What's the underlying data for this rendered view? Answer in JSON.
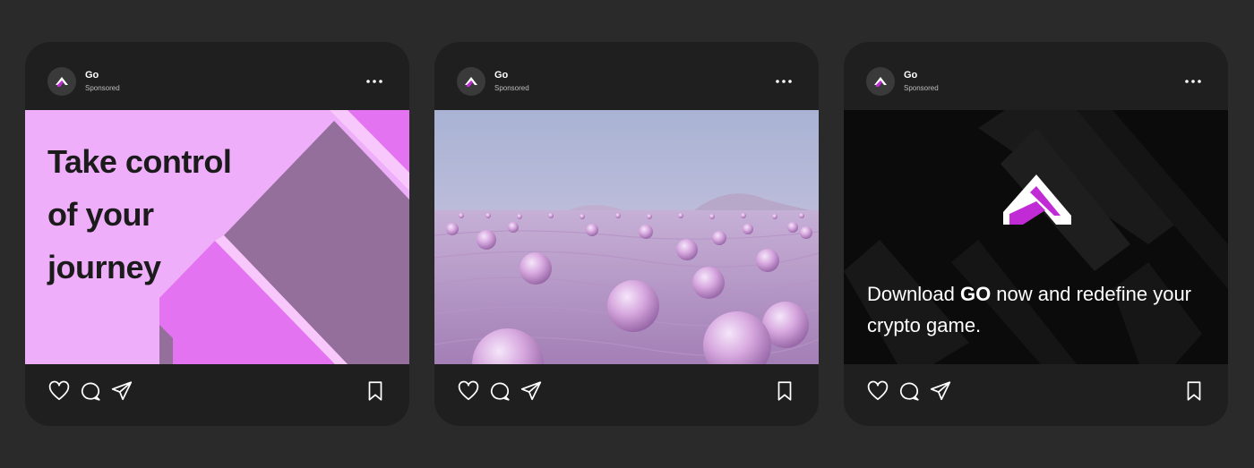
{
  "posts": [
    {
      "brand": "Go",
      "sponsored": "Sponsored",
      "headline": "Take control of your journey"
    },
    {
      "brand": "Go",
      "sponsored": "Sponsored"
    },
    {
      "brand": "Go",
      "sponsored": "Sponsored",
      "tagline_before": "Download ",
      "tagline_bold": "GO",
      "tagline_after": " now and redefine your crypto game."
    }
  ],
  "icons": {
    "brand_logo": "go-logo-icon",
    "more": "more-options-icon",
    "like": "heart-icon",
    "comment": "comment-icon",
    "share": "send-icon",
    "save": "bookmark-icon"
  },
  "colors": {
    "page_bg": "#2a2a2a",
    "card_bg": "#1f1f1f",
    "accent_magenta": "#c12bd6",
    "pink_bg": "#efaefa"
  }
}
